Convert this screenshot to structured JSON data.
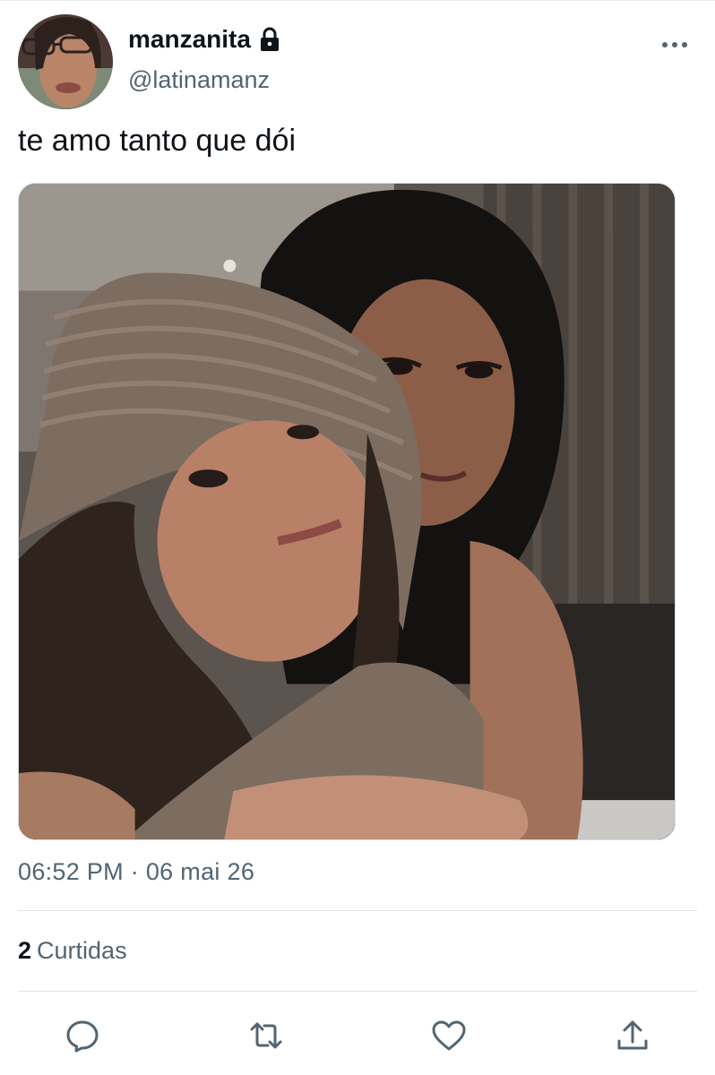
{
  "author": {
    "display_name": "manzanita",
    "handle": "@latinamanz",
    "protected_icon": "lock-icon",
    "avatar": "profile-photo"
  },
  "menu_icon": "more-horizontal-icon",
  "tweet": {
    "text": "te amo tanto que dói",
    "image": "photo-of-two-girls",
    "timestamp": "06:52 PM · 06 mai 26"
  },
  "stats": {
    "likes_count": "2",
    "likes_label": "Curtidas"
  },
  "actions": [
    {
      "name": "reply",
      "icon": "speech-bubble-icon"
    },
    {
      "name": "retweet",
      "icon": "retweet-arrows-icon"
    },
    {
      "name": "like",
      "icon": "heart-icon"
    },
    {
      "name": "share",
      "icon": "share-upload-icon"
    }
  ],
  "colors": {
    "text_primary": "#0f1419",
    "text_secondary": "#536471",
    "divider": "#e1e5e8"
  }
}
